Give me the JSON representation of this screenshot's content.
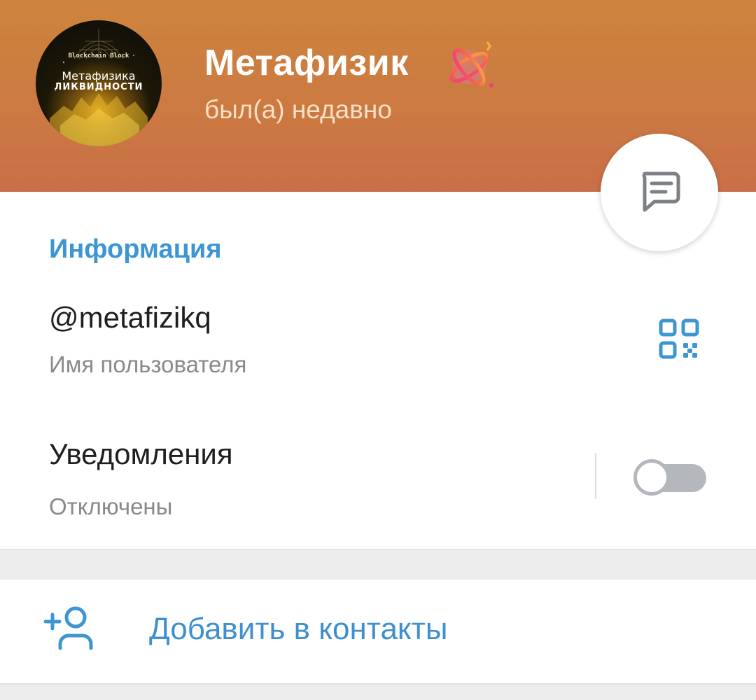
{
  "header": {
    "avatar": {
      "top_text": "Blockchain Block",
      "line1": "Метафизика",
      "line2": "ЛИКВИДНОСТИ"
    },
    "name": "Метафизик",
    "status": "был(а) недавно",
    "premium_icon": "premium-atom-icon",
    "gradient_colors": [
      "#cd843c",
      "#c96f48"
    ]
  },
  "fab": {
    "icon": "message-icon"
  },
  "info": {
    "title": "Информация",
    "username": {
      "value": "@metafizikq",
      "label": "Имя пользователя",
      "action_icon": "qr-code-icon"
    },
    "notifications": {
      "title": "Уведомления",
      "value": "Отключены",
      "enabled": false
    }
  },
  "actions": {
    "add_contact": {
      "icon": "add-user-icon",
      "label": "Добавить в контакты"
    }
  },
  "colors": {
    "accent": "#3d96d3",
    "link": "#3d8fd0",
    "secondary_text": "#8a8a8a",
    "toggle_off": "#b4b8bc"
  }
}
